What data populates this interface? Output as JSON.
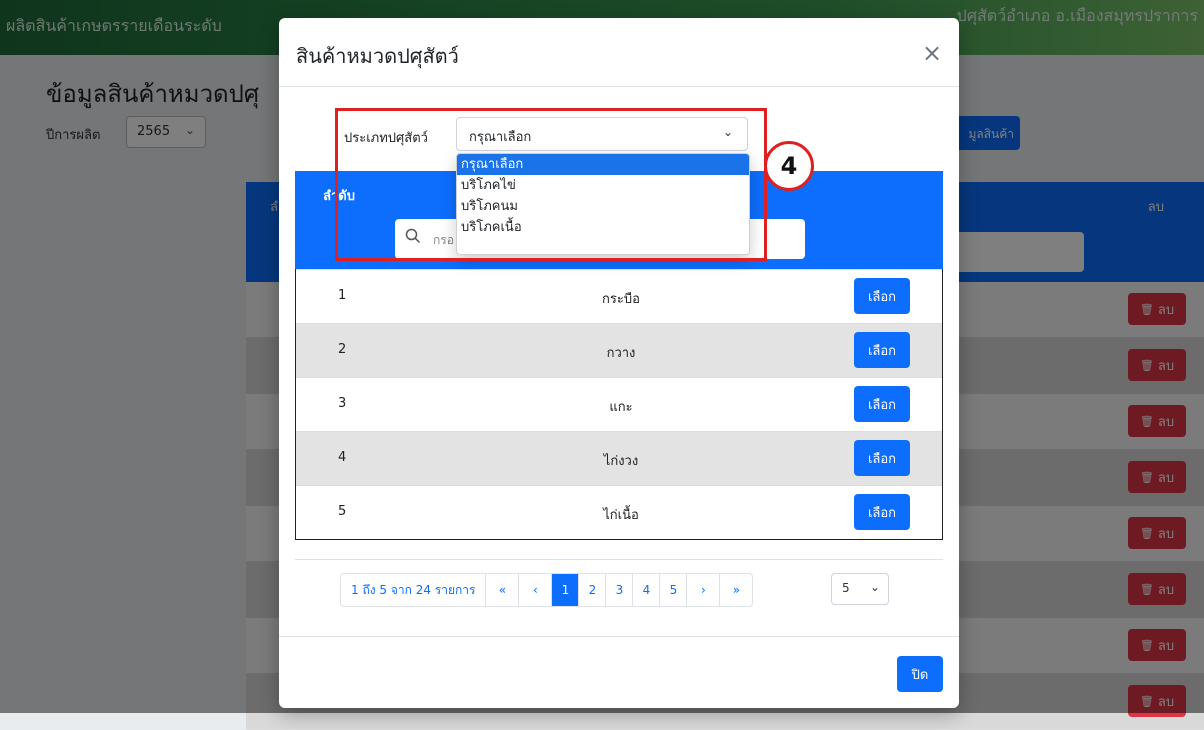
{
  "background": {
    "header_left": "ผลิตสินค้าเกษตรรายเดือนระดับ",
    "header_right": "ปศุสัตว์อำเภอ อ.เมืองสมุทรปราการ",
    "page_title": "ข้อมูลสินค้าหมวดปศุ",
    "year_label": "ปีการผลิต",
    "year_value": "2565",
    "add_button": "มูลสินค้า",
    "col_order": "ลำดับ",
    "col_delete": "ลบ",
    "delete_label": "ลบ",
    "row_count": 8
  },
  "modal": {
    "title": "สินค้าหมวดปศุสัตว์",
    "close_symbol": "×",
    "filter_label": "ประเภทปศุสัตว์",
    "select_value": "กรุณาเลือก",
    "dropdown_options": [
      "กรุณาเลือก",
      "บริโภคไข่",
      "บริโภคนม",
      "บริโภคเนื้อ"
    ],
    "table": {
      "col_order": "ลำดับ",
      "search_placeholder": "กรอ",
      "rows": [
        {
          "num": "1",
          "name": "กระบือ",
          "action": "เลือก"
        },
        {
          "num": "2",
          "name": "กวาง",
          "action": "เลือก"
        },
        {
          "num": "3",
          "name": "แกะ",
          "action": "เลือก"
        },
        {
          "num": "4",
          "name": "ไก่งวง",
          "action": "เลือก"
        },
        {
          "num": "5",
          "name": "ไก่เนื้อ",
          "action": "เลือก"
        }
      ]
    },
    "pagination": {
      "info": "1 ถึง 5 จาก 24 รายการ",
      "first": "«",
      "prev": "‹",
      "pages": [
        "1",
        "2",
        "3",
        "4",
        "5"
      ],
      "active_page": "1",
      "next": "›",
      "last": "»",
      "page_size": "5"
    },
    "close_button": "ปิด"
  },
  "annotation": {
    "step_number": "4",
    "color": "#e02020"
  },
  "colors": {
    "primary": "#0d6efd",
    "danger": "#dc3545",
    "dropdown_selected": "#1a73e8"
  }
}
